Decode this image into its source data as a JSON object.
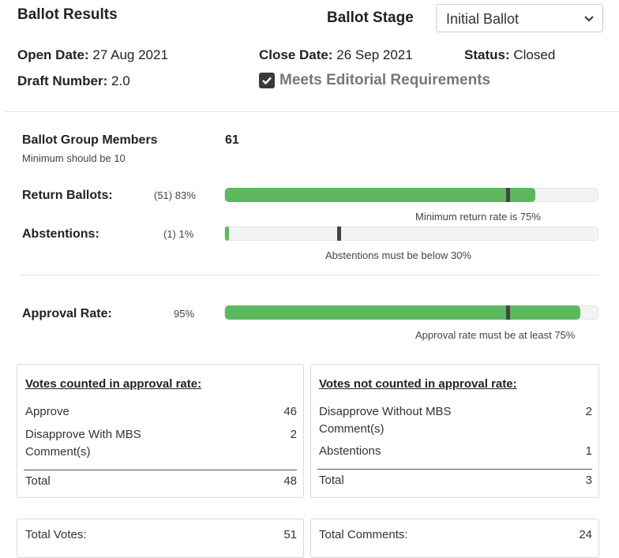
{
  "header": {
    "title": "Ballot Results",
    "stage_label": "Ballot Stage",
    "stage_select": "Initial Ballot",
    "open_date_label": "Open Date:",
    "open_date": "27 Aug 2021",
    "close_date_label": "Close Date:",
    "close_date": "26 Sep 2021",
    "status_label": "Status:",
    "status": "Closed",
    "draft_label": "Draft Number:",
    "draft": "2.0",
    "meets_label": "Meets Editorial Requirements",
    "meets_checked": true
  },
  "members": {
    "label": "Ballot Group Members",
    "value": "61",
    "note": "Minimum should be 10"
  },
  "return_ballots": {
    "label": "Return Ballots:",
    "value": "(51) 83%",
    "fraction": 0.83,
    "threshold": 0.75,
    "note": "Minimum return rate is 75%"
  },
  "abstentions": {
    "label": "Abstentions:",
    "value": "(1) 1%",
    "fraction": 0.01,
    "threshold": 0.3,
    "note": "Abstentions must be below 30%"
  },
  "approval": {
    "label": "Approval Rate:",
    "value": "95%",
    "fraction": 0.95,
    "threshold": 0.75,
    "note": "Approval rate must be at least 75%"
  },
  "counted": {
    "title": "Votes counted in approval rate:",
    "rows": [
      {
        "label": "Approve",
        "value": "46"
      },
      {
        "label": "Disapprove With MBS Comment(s)",
        "value": "2"
      }
    ],
    "total_label": "Total",
    "total": "48"
  },
  "not_counted": {
    "title": "Votes not counted in approval rate:",
    "rows": [
      {
        "label": "Disapprove Without MBS Comment(s)",
        "value": "2"
      },
      {
        "label": "Abstentions",
        "value": "1"
      }
    ],
    "total_label": "Total",
    "total": "3"
  },
  "totals": {
    "votes_label": "Total Votes:",
    "votes": "51",
    "comments_label": "Total Comments:",
    "comments": "24"
  },
  "colors": {
    "fill": "#5cb85c",
    "marker": "#444444"
  }
}
